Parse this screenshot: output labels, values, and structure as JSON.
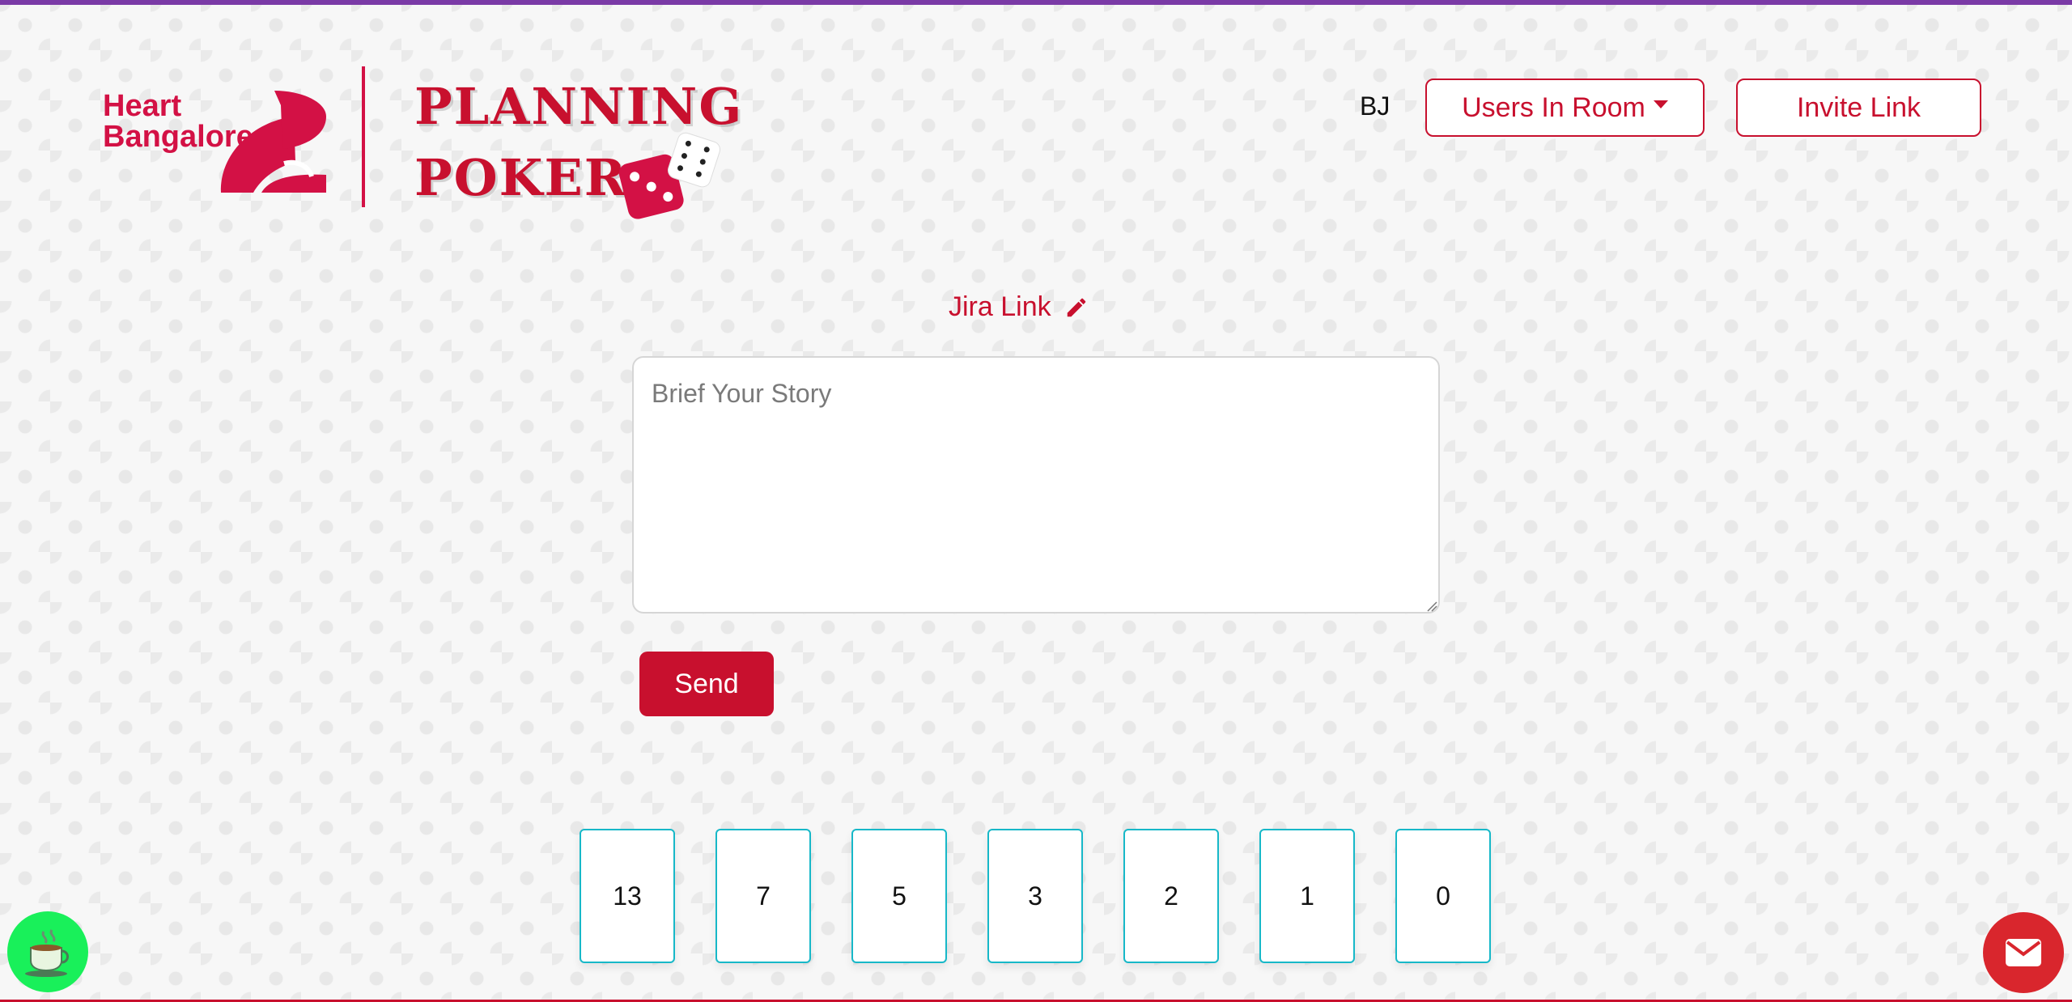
{
  "brand": {
    "logo_text_line1": "Heart",
    "logo_text_line2": "Bangalore",
    "title_line1": "PLANNING",
    "title_line2": "POKER",
    "accent_color": "#c8102e"
  },
  "header": {
    "user_initials": "BJ",
    "users_in_room_label": "Users In Room",
    "invite_link_label": "Invite Link"
  },
  "story": {
    "jira_link_label": "Jira Link",
    "placeholder": "Brief Your Story",
    "value": "",
    "send_label": "Send"
  },
  "cards": [
    "13",
    "7",
    "5",
    "3",
    "2",
    "1",
    "0"
  ],
  "floating": {
    "coffee_icon": "coffee-cup-icon",
    "coffee_color": "#19f05a",
    "mail_icon": "envelope-icon",
    "mail_color": "#d9262d"
  }
}
